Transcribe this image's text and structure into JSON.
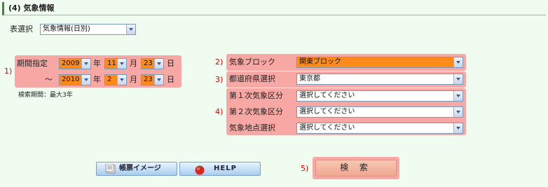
{
  "section": {
    "title": "(4) 気象情報"
  },
  "table_select": {
    "label": "表選択",
    "value": "気象情報(日別)"
  },
  "period": {
    "marker": "1)",
    "label": "期間指定",
    "from": {
      "year": "2009",
      "month": "11",
      "day": "23"
    },
    "to": {
      "year": "2010",
      "month": "2",
      "day": "23"
    },
    "tilde": "～",
    "year_unit": "年",
    "month_unit": "月",
    "day_unit": "日",
    "note": "検索期間：最大3年"
  },
  "block": {
    "marker": "2)",
    "label": "気象ブロック",
    "value": "関東ブロック"
  },
  "prefecture": {
    "marker": "3)",
    "label": "都道府県選択",
    "value": "東京都"
  },
  "areas": {
    "marker": "4)",
    "first": {
      "label": "第１次気象区分",
      "value": "選択してください"
    },
    "second": {
      "label": "第２次気象区分",
      "value": "選択してください"
    },
    "point": {
      "label": "気象地点選択",
      "value": "選択してください"
    }
  },
  "buttons": {
    "report_image": "帳票イメージ",
    "help": "HELP",
    "search_marker": "5)",
    "search": "検 索"
  }
}
